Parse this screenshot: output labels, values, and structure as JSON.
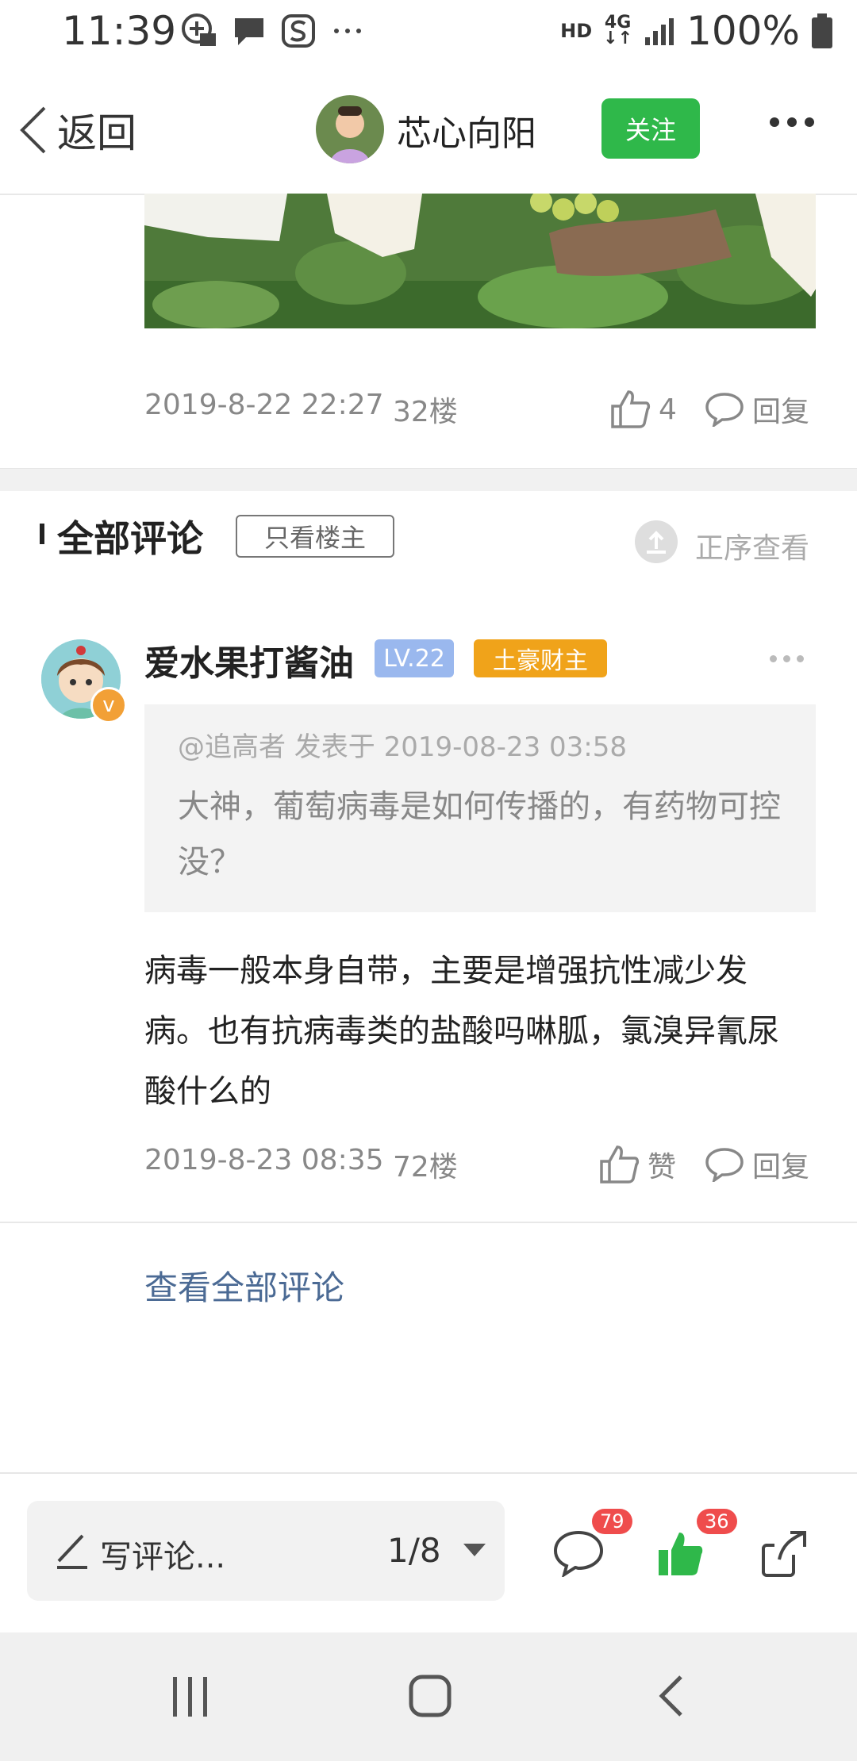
{
  "status_bar": {
    "time": "11:39",
    "network_hd": "HD",
    "network_4g": "4G",
    "battery": "100%",
    "left_icons": [
      "add-contact-icon",
      "message-icon",
      "sogou-icon",
      "more-notifications-icon"
    ]
  },
  "header": {
    "back_label": "返回",
    "author_name": "芯心向阳",
    "follow_label": "关注"
  },
  "post_meta": {
    "date": "2019-8-22 22:27",
    "floor": "32楼",
    "like_count": "4",
    "reply_label": "回复"
  },
  "comments_section": {
    "title": "全部评论",
    "only_owner_label": "只看楼主",
    "sort_label": "正序查看"
  },
  "comment": {
    "user_name": "爱水果打酱油",
    "level": "LV.22",
    "badge": "土豪财主",
    "quote_meta": "@追高者 发表于 2019-08-23 03:58",
    "quote_text": "大神，葡萄病毒是如何传播的，有药物可控没？",
    "body": "病毒一般本身自带，主要是增强抗性减少发病。也有抗病毒类的盐酸吗啉胍，氯溴异氰尿酸什么的",
    "date": "2019-8-23 08:35",
    "floor": "72楼",
    "like_label": "赞",
    "reply_label": "回复"
  },
  "view_all_label": "查看全部评论",
  "bottom_bar": {
    "write_placeholder": "写评论...",
    "page_indicator": "1/8",
    "comment_count": "79",
    "like_count": "36"
  },
  "colors": {
    "accent_green": "#2fb84a",
    "link_blue": "#4b6a94",
    "badge_red": "#ef4c4c"
  }
}
